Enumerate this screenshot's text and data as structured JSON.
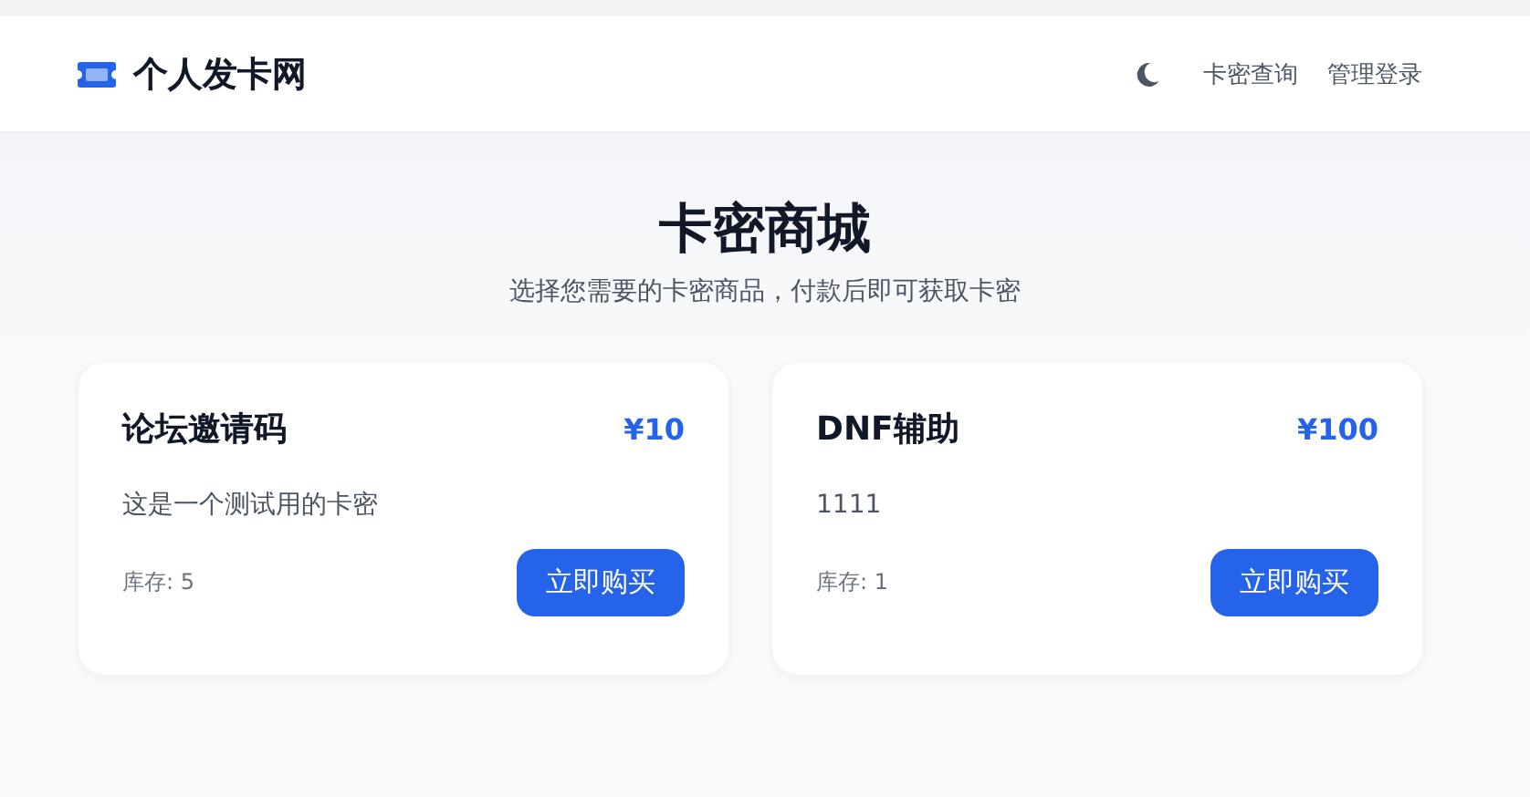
{
  "header": {
    "brand": "个人发卡网",
    "nav": [
      "卡密查询",
      "管理登录"
    ]
  },
  "hero": {
    "title": "卡密商城",
    "subtitle": "选择您需要的卡密商品，付款后即可获取卡密"
  },
  "products": [
    {
      "name": "论坛邀请码",
      "price": "¥10",
      "description": "这是一个测试用的卡密",
      "stock": "库存: 5",
      "button": "立即购买"
    },
    {
      "name": "DNF辅助",
      "price": "¥100",
      "description": "1111",
      "stock": "库存: 1",
      "button": "立即购买"
    }
  ]
}
